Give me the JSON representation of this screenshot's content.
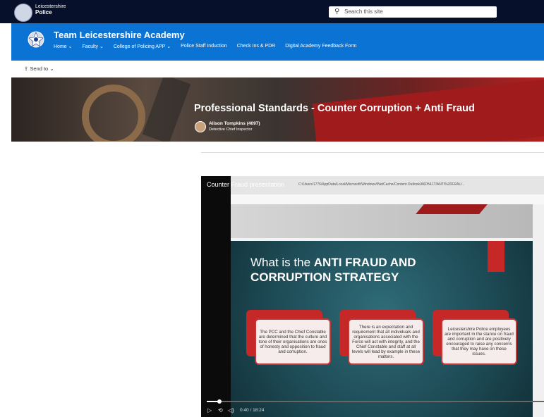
{
  "topbar": {
    "org_name": "Leicestershire",
    "org_sub": "Police",
    "search_placeholder": "Search this site"
  },
  "site": {
    "title": "Team Leicestershire Academy",
    "nav": [
      "Home ⌄",
      "Faculty ⌄",
      "College of Policing APP ⌄",
      "Police Staff Induction",
      "Check Ins & PDR",
      "Digital Academy Feedback Form"
    ]
  },
  "command_bar": {
    "send_to": "Send to ⌄"
  },
  "page": {
    "title": "Professional Standards - Counter Corruption + Anti Fraud",
    "author_name": "Alison Tompkins (4097)",
    "author_role": "Detective Chief Inspector"
  },
  "video": {
    "title": "Counter Fraud presentation",
    "file_path": "C:/Users/1776/AppData/Local/Microsoft/Windows/INetCache/Content.Outlook/A6D541T/ANTI%20FRAU...",
    "slide_heading_pre": "What is the ",
    "slide_heading_bold1": "ANTI FRAUD AND",
    "slide_heading_bold2": "CORRUPTION STRATEGY",
    "boxes": [
      "The PCC and the Chief Constable are determined that the culture and tone of their organisations are ones of honesty and opposition to fraud and corruption.",
      "There is an expectation and requirement that all individuals and organisations associated with the Force will act with integrity, and the Chief Constable and staff at all levels will lead by example in these matters.",
      "Leicestershire Police employees are important in the stance on fraud and corruption and are positively encouraged to raise any concerns that they may have on these issues."
    ],
    "time": "0:40 / 18:24",
    "progress": 0.037
  }
}
